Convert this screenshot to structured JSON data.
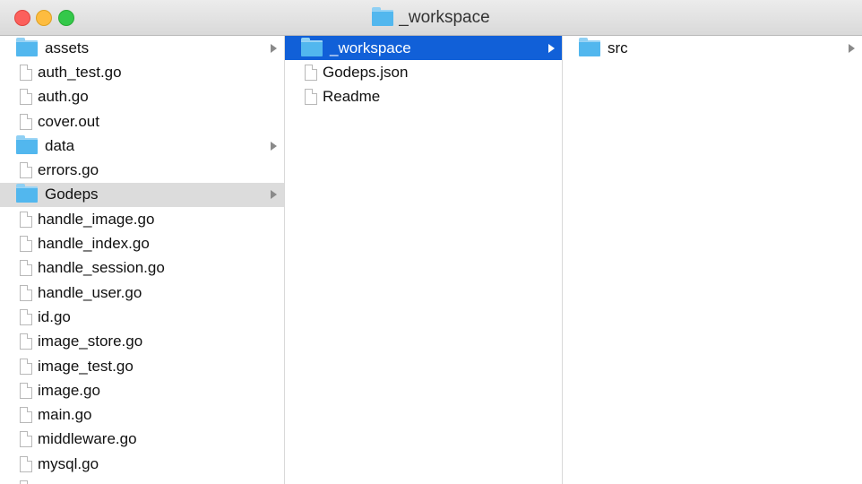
{
  "window": {
    "title": "_workspace"
  },
  "columns": [
    {
      "items": [
        {
          "name": "assets",
          "kind": "folder",
          "expandable": true
        },
        {
          "name": "auth_test.go",
          "kind": "file"
        },
        {
          "name": "auth.go",
          "kind": "file"
        },
        {
          "name": "cover.out",
          "kind": "file"
        },
        {
          "name": "data",
          "kind": "folder",
          "expandable": true
        },
        {
          "name": "errors.go",
          "kind": "file"
        },
        {
          "name": "Godeps",
          "kind": "folder",
          "expandable": true,
          "selected": "gray"
        },
        {
          "name": "handle_image.go",
          "kind": "file"
        },
        {
          "name": "handle_index.go",
          "kind": "file"
        },
        {
          "name": "handle_session.go",
          "kind": "file"
        },
        {
          "name": "handle_user.go",
          "kind": "file"
        },
        {
          "name": "id.go",
          "kind": "file"
        },
        {
          "name": "image_store.go",
          "kind": "file"
        },
        {
          "name": "image_test.go",
          "kind": "file"
        },
        {
          "name": "image.go",
          "kind": "file"
        },
        {
          "name": "main.go",
          "kind": "file"
        },
        {
          "name": "middleware.go",
          "kind": "file"
        },
        {
          "name": "mysql.go",
          "kind": "file"
        },
        {
          "name": "",
          "kind": "file"
        }
      ]
    },
    {
      "items": [
        {
          "name": "_workspace",
          "kind": "folder",
          "expandable": true,
          "selected": "blue"
        },
        {
          "name": "Godeps.json",
          "kind": "file"
        },
        {
          "name": "Readme",
          "kind": "file"
        }
      ]
    },
    {
      "items": [
        {
          "name": "src",
          "kind": "folder",
          "expandable": true
        }
      ]
    }
  ]
}
